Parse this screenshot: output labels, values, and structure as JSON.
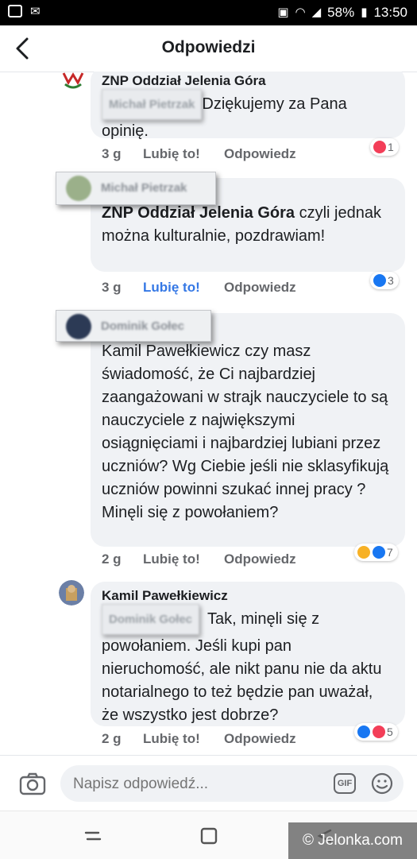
{
  "status_bar": {
    "battery": "58%",
    "time": "13:50"
  },
  "header": {
    "title": "Odpowiedzi"
  },
  "comments": [
    {
      "author": "ZNP Oddział Jelenia Góra",
      "mention": "Michał Pietrzak",
      "text": "Dziękujemy za Pana opinię.",
      "time": "3 g",
      "like_label": "Lubię to!",
      "reply_label": "Odpowiedz",
      "reaction_count": "1"
    },
    {
      "author": "Michał Pietrzak",
      "mention": "ZNP Oddział Jelenia Góra",
      "text": "czyli jednak można kulturalnie, pozdrawiam!",
      "time": "3 g",
      "like_label": "Lubię to!",
      "reply_label": "Odpowiedz",
      "reaction_count": "3"
    },
    {
      "author": "Dominik Gołec",
      "mention": "Kamil Pawełkiewicz",
      "text": "czy masz świadomość, że Ci najbardziej zaangażowani w strajk nauczyciele to są nauczyciele z największymi osiągnięciami i najbardziej  lubiani przez uczniów?  Wg Ciebie jeśli nie sklasyfikują uczniów powinni szukać innej pracy ? Minęli się z powołaniem?",
      "time": "2 g",
      "like_label": "Lubię to!",
      "reply_label": "Odpowiedz",
      "reaction_count": "7"
    },
    {
      "author": "Kamil Pawełkiewicz",
      "mention": "Dominik Gołec",
      "text": "Tak, minęli się z powołaniem. Jeśli kupi pan nieruchomość, ale nikt panu  nie da aktu notarialnego to też będzie pan uważał, że wszystko jest dobrze?",
      "time": "2 g",
      "like_label": "Lubię to!",
      "reply_label": "Odpowiedz",
      "reaction_count": "5"
    }
  ],
  "composer": {
    "placeholder": "Napisz odpowiedź...",
    "gif_label": "GIF"
  },
  "watermark": "© Jelonka.com",
  "colors": {
    "accent": "#3578e5",
    "bubble": "#f0f2f5",
    "like": "#1877f2",
    "love": "#f33e58"
  }
}
